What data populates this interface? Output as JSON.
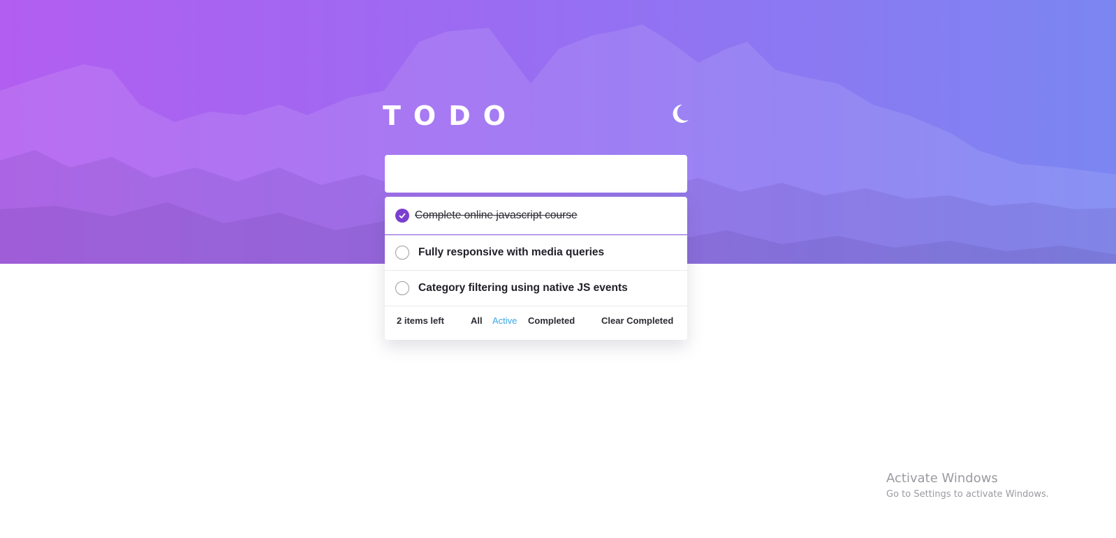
{
  "app": {
    "title": "TODO",
    "theme_icon": "moon-icon"
  },
  "new_todo": {
    "value": "",
    "placeholder": ""
  },
  "todos": [
    {
      "text": "Complete online javascript course",
      "completed": true
    },
    {
      "text": "Fully responsive with media queries",
      "completed": false
    },
    {
      "text": "Category filtering using native JS events",
      "completed": false
    }
  ],
  "footer": {
    "items_left": "2 items left",
    "filters": {
      "all": "All",
      "active": "Active",
      "completed": "Completed"
    },
    "selected_filter": "active",
    "clear_completed": "Clear Completed"
  },
  "colors": {
    "gradient_start": "#b25ef0",
    "gradient_end": "#7b86f2",
    "check_purple": "#7b3fcf",
    "active_filter": "#3aa7e8"
  },
  "windows_watermark": {
    "title": "Activate Windows",
    "subtitle": "Go to Settings to activate Windows."
  }
}
